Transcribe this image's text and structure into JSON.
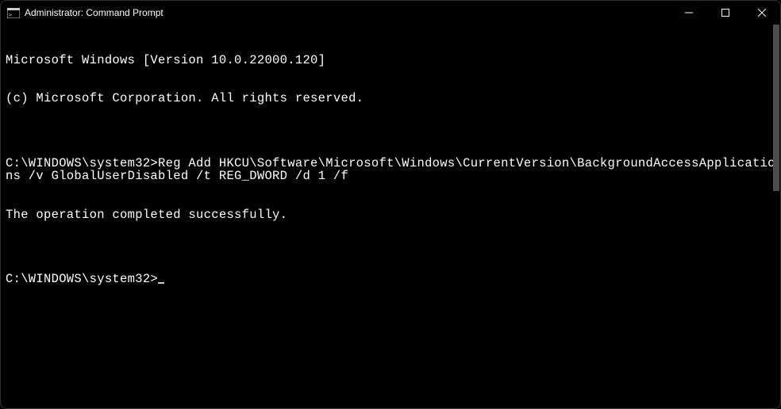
{
  "titlebar": {
    "title": "Administrator: Command Prompt"
  },
  "terminal": {
    "line1": "Microsoft Windows [Version 10.0.22000.120]",
    "line2": "(c) Microsoft Corporation. All rights reserved.",
    "blank1": "",
    "prompt1": "C:\\WINDOWS\\system32>",
    "command1": "Reg Add HKCU\\Software\\Microsoft\\Windows\\CurrentVersion\\BackgroundAccessApplications /v GlobalUserDisabled /t REG_DWORD /d 1 /f",
    "result1": "The operation completed successfully.",
    "blank2": "",
    "prompt2": "C:\\WINDOWS\\system32>"
  }
}
